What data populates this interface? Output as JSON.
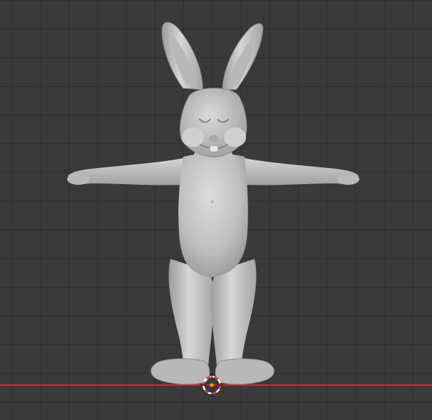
{
  "viewport": {
    "mode": "sculpt",
    "background_color": "#3a3a3a",
    "grid_color": "#2f2f2f",
    "x_axis_color": "#b5363f"
  },
  "model": {
    "name": "rabbit",
    "pose": "T-pose",
    "material_color": "#c9c9c9"
  },
  "cursor_3d": {
    "icon": "3d-cursor-icon",
    "ring_colors": [
      "#e0333a",
      "#ffffff"
    ],
    "center_color": "#ff9a00"
  }
}
